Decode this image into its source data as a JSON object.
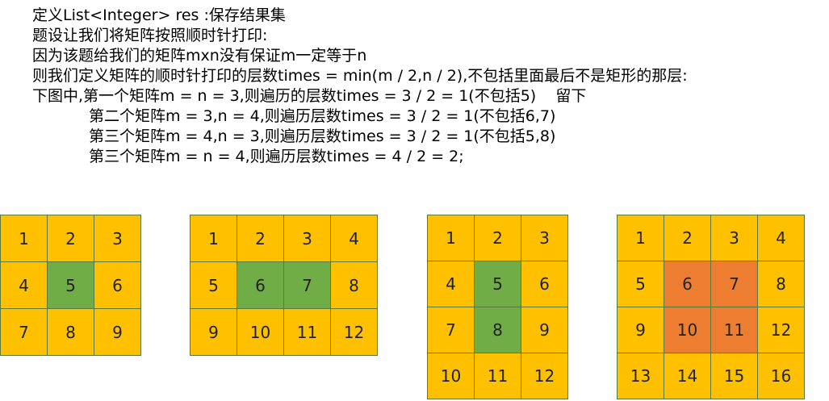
{
  "colors": {
    "outer": "#FFC000",
    "inner_green": "#70AD47",
    "inner_orange": "#ED7D31"
  },
  "lines": [
    "定义List<Integer> res :保存结果集",
    "题设让我们将矩阵按照顺时针打印:",
    "因为该题给我们的矩阵mxn没有保证m一定等于n",
    "则我们定义矩阵的顺时针打印的层数times = min(m / 2,n / 2),不包括里面最后不是矩形的那层:",
    "下图中,第一个矩阵m = n = 3,则遍历的层数times = 3 / 2 = 1(不包括5)    留下",
    "第二个矩阵m = 3,n = 4,则遍历层数times = 3 / 2 = 1(不包括6,7)",
    "第三个矩阵m = 4,n = 3,则遍历层数times = 3 / 2 = 1(不包括5,8)",
    "第三个矩阵m = n = 4,则遍历层数times = 4 / 2 = 2;"
  ],
  "matrices": [
    {
      "rows": [
        [
          {
            "v": "1",
            "c": "outer"
          },
          {
            "v": "2",
            "c": "outer"
          },
          {
            "v": "3",
            "c": "outer"
          }
        ],
        [
          {
            "v": "4",
            "c": "outer"
          },
          {
            "v": "5",
            "c": "inner_green"
          },
          {
            "v": "6",
            "c": "outer"
          }
        ],
        [
          {
            "v": "7",
            "c": "outer"
          },
          {
            "v": "8",
            "c": "outer"
          },
          {
            "v": "9",
            "c": "outer"
          }
        ]
      ]
    },
    {
      "rows": [
        [
          {
            "v": "1",
            "c": "outer"
          },
          {
            "v": "2",
            "c": "outer"
          },
          {
            "v": "3",
            "c": "outer"
          },
          {
            "v": "4",
            "c": "outer"
          }
        ],
        [
          {
            "v": "5",
            "c": "outer"
          },
          {
            "v": "6",
            "c": "inner_green"
          },
          {
            "v": "7",
            "c": "inner_green"
          },
          {
            "v": "8",
            "c": "outer"
          }
        ],
        [
          {
            "v": "9",
            "c": "outer"
          },
          {
            "v": "10",
            "c": "outer"
          },
          {
            "v": "11",
            "c": "outer"
          },
          {
            "v": "12",
            "c": "outer"
          }
        ]
      ]
    },
    {
      "rows": [
        [
          {
            "v": "1",
            "c": "outer"
          },
          {
            "v": "2",
            "c": "outer"
          },
          {
            "v": "3",
            "c": "outer"
          }
        ],
        [
          {
            "v": "4",
            "c": "outer"
          },
          {
            "v": "5",
            "c": "inner_green"
          },
          {
            "v": "6",
            "c": "outer"
          }
        ],
        [
          {
            "v": "7",
            "c": "outer"
          },
          {
            "v": "8",
            "c": "inner_green"
          },
          {
            "v": "9",
            "c": "outer"
          }
        ],
        [
          {
            "v": "10",
            "c": "outer"
          },
          {
            "v": "11",
            "c": "outer"
          },
          {
            "v": "12",
            "c": "outer"
          }
        ]
      ]
    },
    {
      "rows": [
        [
          {
            "v": "1",
            "c": "outer"
          },
          {
            "v": "2",
            "c": "outer"
          },
          {
            "v": "3",
            "c": "outer"
          },
          {
            "v": "4",
            "c": "outer"
          }
        ],
        [
          {
            "v": "5",
            "c": "outer"
          },
          {
            "v": "6",
            "c": "inner_orange"
          },
          {
            "v": "7",
            "c": "inner_orange"
          },
          {
            "v": "8",
            "c": "outer"
          }
        ],
        [
          {
            "v": "9",
            "c": "outer"
          },
          {
            "v": "10",
            "c": "inner_orange"
          },
          {
            "v": "11",
            "c": "inner_orange"
          },
          {
            "v": "12",
            "c": "outer"
          }
        ],
        [
          {
            "v": "13",
            "c": "outer"
          },
          {
            "v": "14",
            "c": "outer"
          },
          {
            "v": "15",
            "c": "outer"
          },
          {
            "v": "16",
            "c": "outer"
          }
        ]
      ]
    }
  ]
}
